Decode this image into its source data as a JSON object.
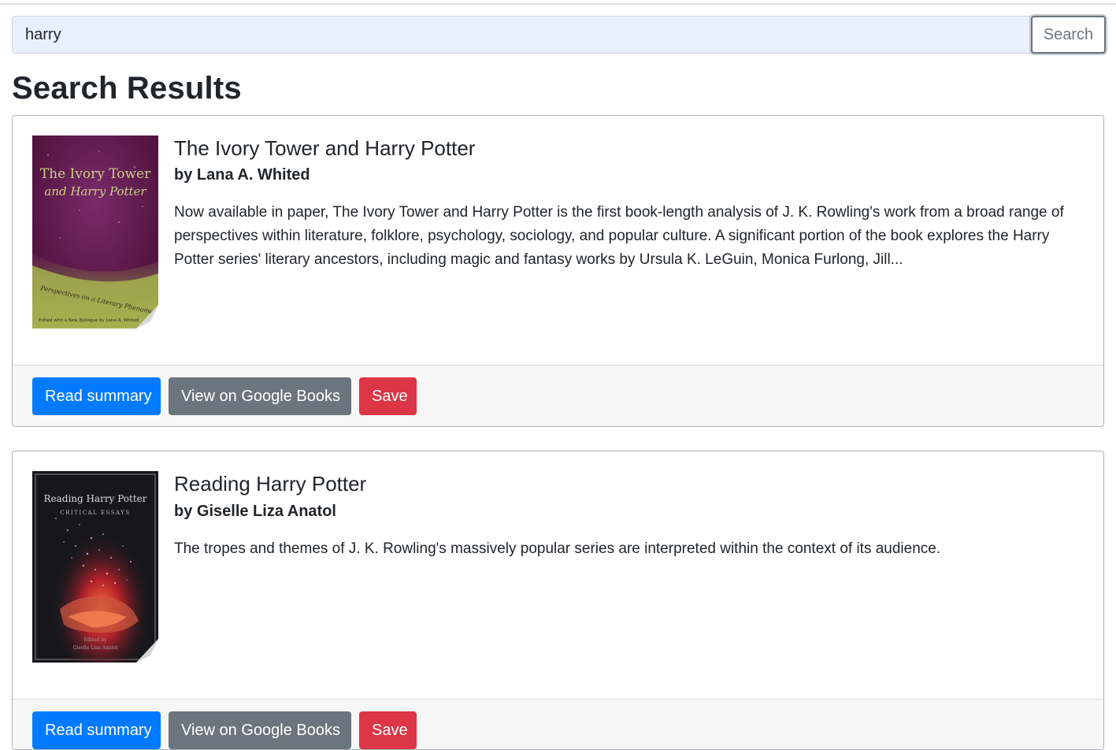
{
  "search": {
    "value": "harry",
    "button_label": "Search"
  },
  "page_title": "Search Results",
  "results": [
    {
      "title": "The Ivory Tower and Harry Potter",
      "author": "by Lana A. Whited",
      "description": "Now available in paper, The Ivory Tower and Harry Potter is the first book-length analysis of J. K. Rowling's work from a broad range of perspectives within literature, folklore, psychology, sociology, and popular culture. A significant portion of the book explores the Harry Potter series' literary ancestors, including magic and fantasy works by Ursula K. LeGuin, Monica Furlong, Jill...",
      "cover": {
        "title_line1": "The Ivory Tower",
        "title_line2": "and Harry Potter",
        "subtitle": "Perspectives on a Literary Phenomenon",
        "byline": "Edited with a New Epilogue by Lana A. Whited"
      },
      "actions": {
        "read_summary": "Read summary",
        "view_google": "View on Google Books",
        "save": "Save"
      }
    },
    {
      "title": "Reading Harry Potter",
      "author": "by Giselle Liza Anatol",
      "description": "The tropes and themes of J. K. Rowling's massively popular series are interpreted within the context of its audience.",
      "cover": {
        "title_line1": "Reading Harry Potter",
        "subtitle": "CRITICAL ESSAYS",
        "byline1": "Edited by",
        "byline2": "Giselle Liza Anatol"
      },
      "actions": {
        "read_summary": "Read summary",
        "view_google": "View on Google Books",
        "save": "Save"
      }
    }
  ],
  "colors": {
    "primary": "#007bff",
    "secondary": "#6c757d",
    "danger": "#dc3545",
    "input_bg": "#e8f0fe"
  }
}
